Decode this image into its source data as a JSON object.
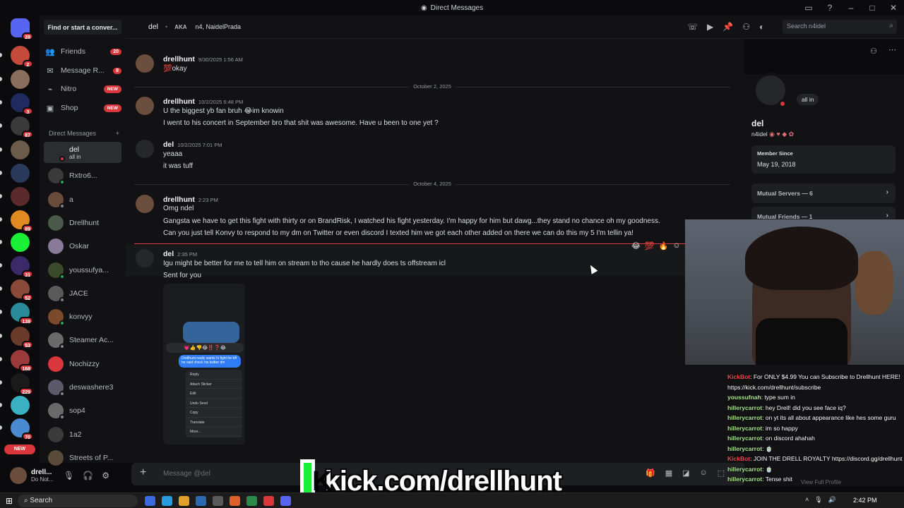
{
  "window": {
    "title": "Direct Messages",
    "icons": [
      "discord-icon",
      "inbox-icon",
      "help-icon",
      "minimize-icon",
      "maximize-icon",
      "close-icon"
    ]
  },
  "rail": {
    "servers": [
      {
        "name": "home",
        "badge": "28",
        "color": "#5865f2"
      },
      {
        "name": "server-1",
        "badge": "2",
        "color": "#c44a3a"
      },
      {
        "name": "server-2",
        "badge": "",
        "color": "#8a6d5a"
      },
      {
        "name": "server-3",
        "badge": "3",
        "color": "#1f2a5e"
      },
      {
        "name": "server-4",
        "badge": "87",
        "color": "#3a3a3a"
      },
      {
        "name": "server-5",
        "badge": "",
        "color": "#6b5b4a"
      },
      {
        "name": "server-6",
        "badge": "",
        "color": "#2a3a5a"
      },
      {
        "name": "server-7",
        "badge": "",
        "color": "#5b2a2a"
      },
      {
        "name": "server-8",
        "badge": "89",
        "color": "#e28a22"
      },
      {
        "name": "server-kick",
        "badge": "",
        "color": "#1af035"
      },
      {
        "name": "server-10",
        "badge": "31",
        "color": "#3a2a6a"
      },
      {
        "name": "server-11",
        "badge": "52",
        "color": "#8a4a3a"
      },
      {
        "name": "server-12",
        "badge": "139",
        "color": "#2a8a9a"
      },
      {
        "name": "server-13",
        "badge": "53",
        "color": "#6a3a2a"
      },
      {
        "name": "server-14",
        "badge": "168",
        "color": "#9a3a3a"
      },
      {
        "name": "server-15",
        "badge": "229",
        "color": "#1a1a1a"
      },
      {
        "name": "server-16",
        "badge": "",
        "color": "#3ab0c0"
      },
      {
        "name": "server-17",
        "badge": "70",
        "color": "#4a8ad0"
      }
    ],
    "new_label": "NEW"
  },
  "sidebar": {
    "find": "Find or start a conver...",
    "nav": [
      {
        "label": "Friends",
        "icon": "friends-icon",
        "glyph": "👥",
        "badge": "20",
        "new": ""
      },
      {
        "label": "Message R...",
        "icon": "mail-icon",
        "glyph": "✉",
        "badge": "8",
        "new": ""
      },
      {
        "label": "Nitro",
        "icon": "nitro-icon",
        "glyph": "⌁",
        "badge": "",
        "new": "NEW"
      },
      {
        "label": "Shop",
        "icon": "shop-icon",
        "glyph": "▣",
        "badge": "",
        "new": "NEW"
      }
    ],
    "dm_header": "Direct Messages",
    "dms": [
      {
        "name": "del",
        "sub": "all in",
        "color": "#2b2d31",
        "status": "#da373c",
        "selected": true
      },
      {
        "name": "Rxtro6...",
        "sub": "",
        "color": "#3a3a3a",
        "status": "#23a55a"
      },
      {
        "name": "a",
        "sub": "",
        "color": "#6a4a3a",
        "status": "#80848e"
      },
      {
        "name": "Drellhunt",
        "sub": "",
        "color": "#4a5a4a",
        "status": ""
      },
      {
        "name": "Oskar",
        "sub": "",
        "color": "#8a7a9a",
        "status": ""
      },
      {
        "name": "youssufya...",
        "sub": "",
        "color": "#3a4a2a",
        "status": "#23a55a"
      },
      {
        "name": "JACE",
        "sub": "",
        "color": "#5a5a5a",
        "status": "#80848e"
      },
      {
        "name": "konvyy",
        "sub": "",
        "color": "#7a4a2a",
        "status": "#23a55a"
      },
      {
        "name": "Steamer Ac...",
        "sub": "",
        "color": "#6a6a6a",
        "status": "#80848e"
      },
      {
        "name": "Nochizzy",
        "sub": "",
        "color": "#da373c",
        "status": ""
      },
      {
        "name": "deswashere3",
        "sub": "",
        "color": "#5a5a6a",
        "status": "#80848e"
      },
      {
        "name": "sop4",
        "sub": "",
        "color": "#6a6a6a",
        "status": "#80848e"
      },
      {
        "name": "1a2",
        "sub": "",
        "color": "#3a3a3a",
        "status": ""
      },
      {
        "name": "Streets of P...",
        "sub": "",
        "color": "#5a4a3a",
        "status": ""
      }
    ]
  },
  "user": {
    "name": "drell...",
    "status": "Do Not..."
  },
  "header": {
    "name": "del",
    "aka": "AKA",
    "aka_names": "n4, NaidelPrada",
    "search_placeholder": "Search n4idel"
  },
  "messages": {
    "items": [
      {
        "author": "drellhunt",
        "time": "9/30/2025 1:56 AM",
        "lines": [
          "💯okay"
        ]
      },
      {
        "divider": "October 2, 2025"
      },
      {
        "author": "drellhunt",
        "time": "10/2/2025 6:48 PM",
        "lines": [
          "U the biggest yb fan bruh 😂im knowin",
          "I went to his concert in September bro that shit was awesome. Have u been to one yet ?"
        ]
      },
      {
        "author": "del",
        "time": "10/2/2025 7:01 PM",
        "lines": [
          "yeaaa",
          "it was tuff"
        ]
      },
      {
        "divider": "October 4, 2025"
      },
      {
        "author": "drellhunt",
        "time": "2:23 PM",
        "lines": [
          "Omg ndel",
          "Gangsta we have to get this fight with thirty or on BrandRisk, I watched his fight yesterday. I'm happy for him but dawg...they stand no chance oh my goodness.",
          "Can you just tell Konvy to respond to my dm on Twitter or even discord I texted him we got each other added on there we can do this my 5 I'm tellin ya!"
        ]
      },
      {
        "author": "del",
        "time": "2:35 PM",
        "lines": [
          "Igu might be better for me to tell him on stream to tho cause he hardly does ts offstream icl",
          "Sent for you"
        ]
      }
    ],
    "reactions": [
      "😂",
      "💯",
      "🔥",
      "☺"
    ],
    "attachment": {
      "bubble": "Drellhunt really wants hi fight for bff he said check his twitter dm",
      "menu": [
        "Reply",
        "Attach Sticker",
        "Edit",
        "Undo Send",
        "Copy",
        "Translate",
        "More..."
      ],
      "emoji": "💗👍👎😂‼️❓😂"
    },
    "compose_placeholder": "Message @del"
  },
  "profile": {
    "status_bubble": "all in",
    "name": "del",
    "username": "n4idel",
    "member_since_label": "Member Since",
    "member_since": "May 19, 2018",
    "mutual_servers": "Mutual Servers — 6",
    "mutual_friends": "Mutual Friends — 1",
    "view_full": "View Full Profile"
  },
  "chat": [
    {
      "user": "KickBot",
      "bot": true,
      "text": ": For ONLY $4.99 You can Subscribe to Drellhunt HERE! https://kick.com/drellhunt/subscribe"
    },
    {
      "user": "youssufnah",
      "text": ": type sum in"
    },
    {
      "user": "hillerycarrot",
      "text": ": hey Drell! did you see face iq?"
    },
    {
      "user": "hillerycarrot",
      "text": ": on yt its all about appearance like hes some guru"
    },
    {
      "user": "hillerycarrot",
      "text": ": im so happy"
    },
    {
      "user": "hillerycarrot",
      "text": ": on discord ahahah"
    },
    {
      "user": "hillerycarrot",
      "text": ": 🍵"
    },
    {
      "user": "KickBot",
      "bot": true,
      "text": ": JOIN THE DRELL ROYALTY https://discord.gg/drellhunt"
    },
    {
      "user": "hillerycarrot",
      "text": ": 🍵"
    },
    {
      "user": "hillerycarrot",
      "text": ": Tense shit"
    }
  ],
  "kick": {
    "logo": "K",
    "url": "kick.com/drellhunt"
  },
  "taskbar": {
    "search": "Search",
    "time": "2:42 PM"
  }
}
